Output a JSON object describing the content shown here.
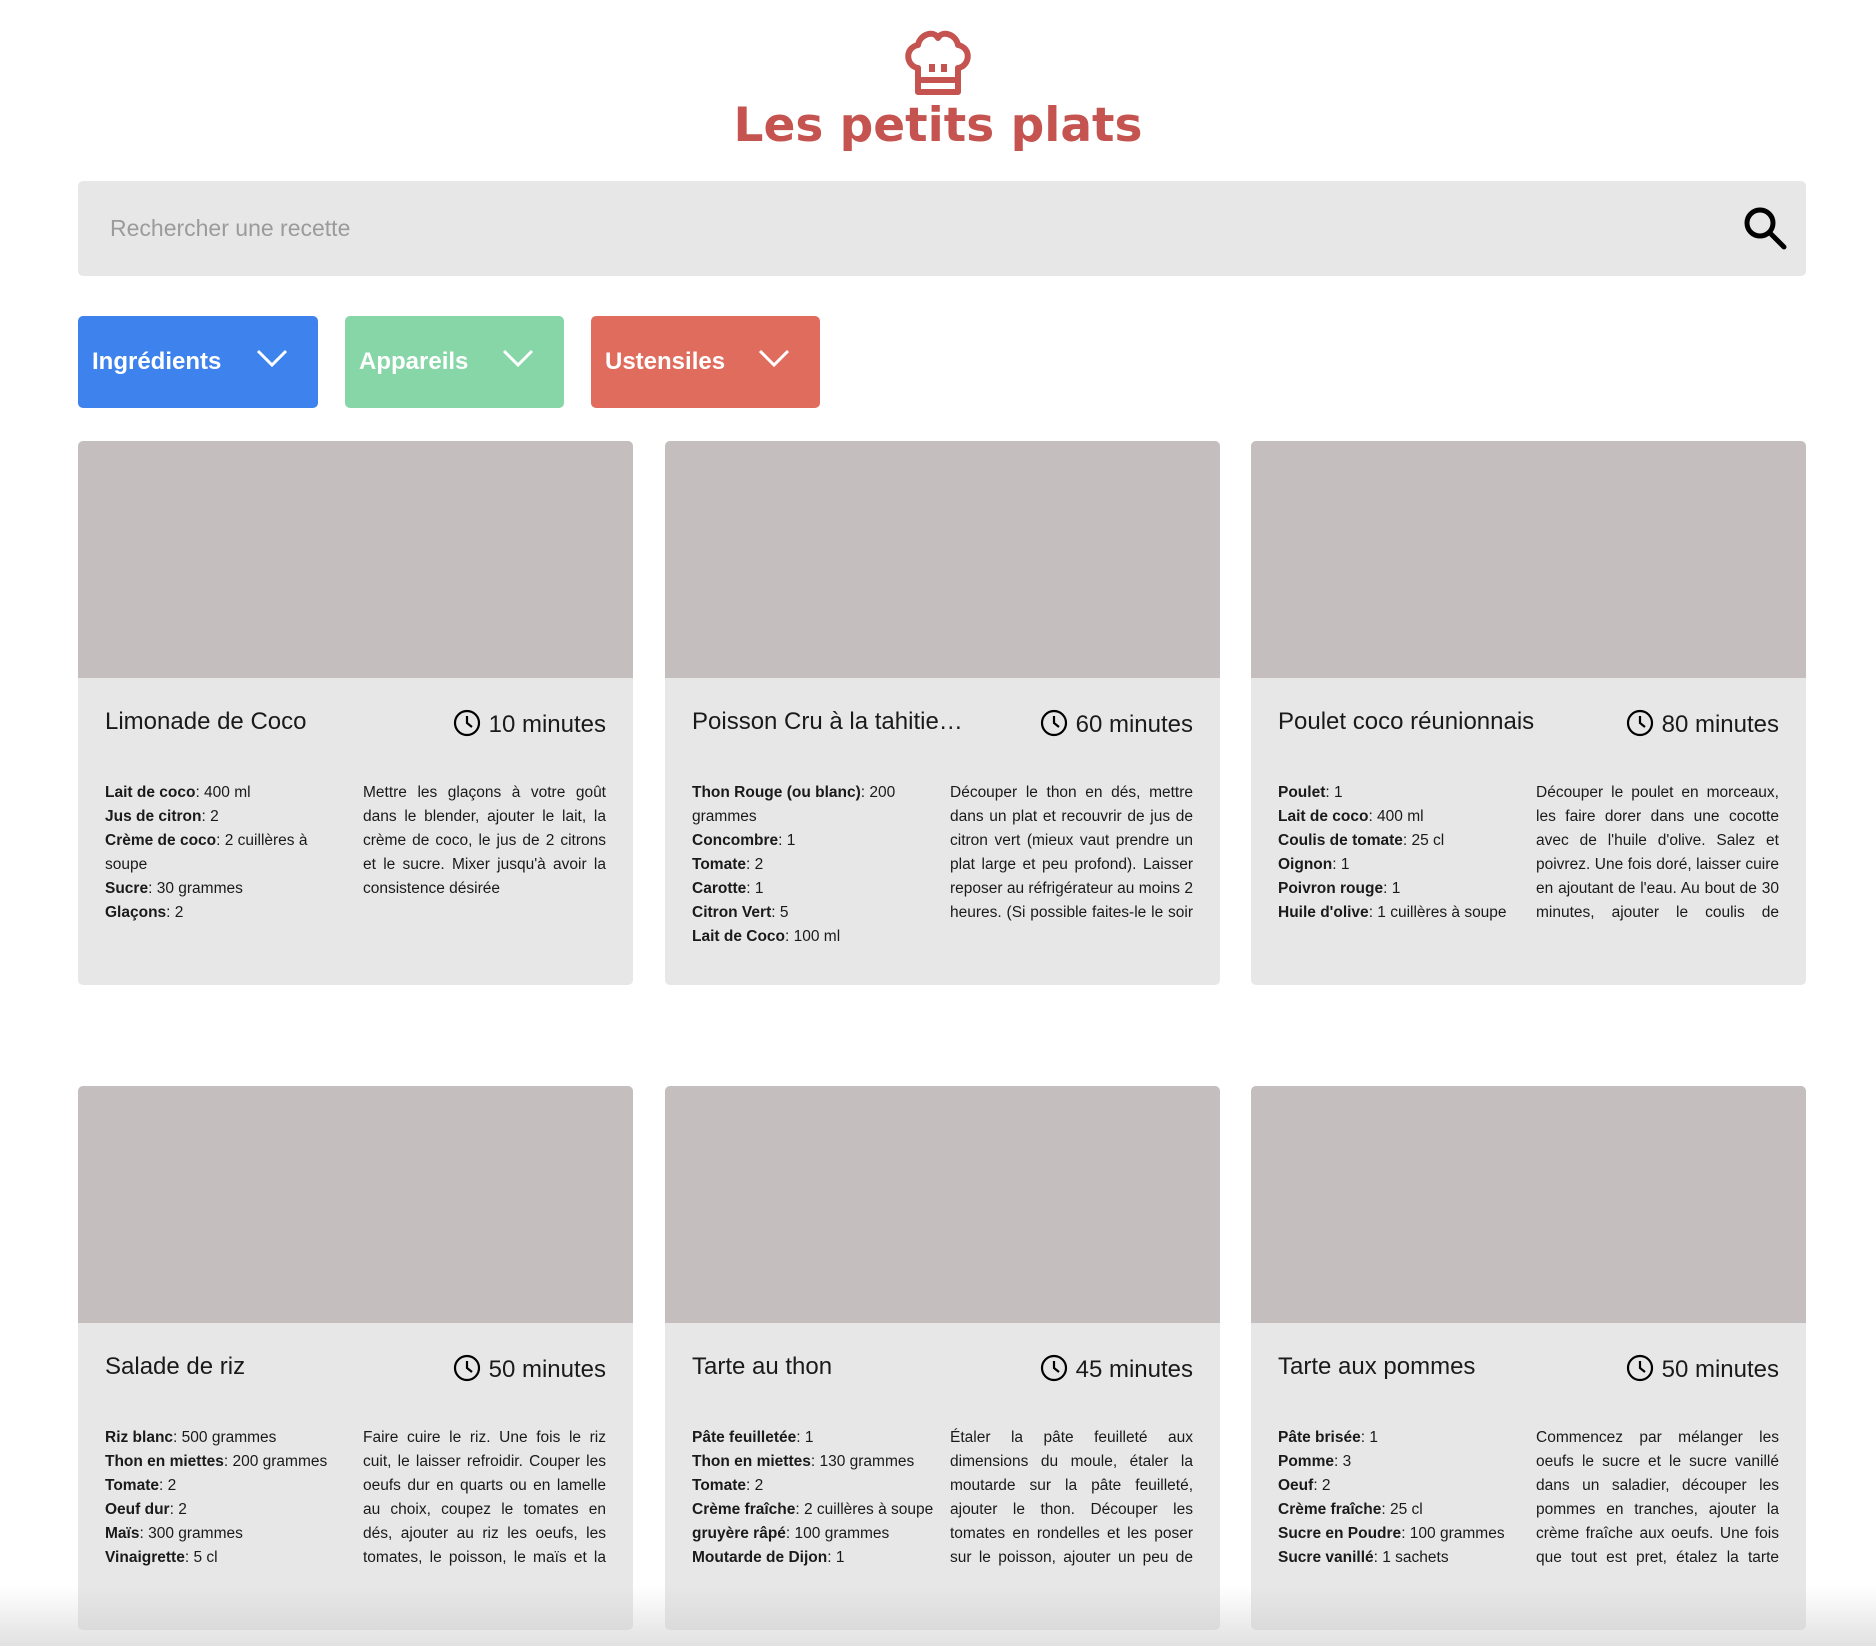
{
  "header": {
    "title": "Les petits plats",
    "logo_icon": "chef-hat-icon",
    "brand_color": "#c5534f"
  },
  "search": {
    "placeholder": "Rechercher une recette",
    "value": "",
    "icon": "search-icon"
  },
  "filters": [
    {
      "label": "Ingrédients",
      "color": "#3e82ed"
    },
    {
      "label": "Appareils",
      "color": "#86d6a8"
    },
    {
      "label": "Ustensiles",
      "color": "#e06c5d"
    }
  ],
  "recipes": [
    {
      "title": "Limonade de Coco",
      "time": "10 minutes",
      "ingredients": [
        {
          "name": "Lait de coco",
          "qty": ": 400 ml"
        },
        {
          "name": "Jus de citron",
          "qty": ": 2"
        },
        {
          "name": "Crème de coco",
          "qty": ": 2 cuillères à soupe"
        },
        {
          "name": "Sucre",
          "qty": ": 30 grammes"
        },
        {
          "name": "Glaçons",
          "qty": ": 2"
        }
      ],
      "description": "Mettre les glaçons à votre goût dans le blender, ajouter le lait, la crème de coco, le jus de 2 citrons et le sucre. Mixer jusqu'à avoir la consistence désirée"
    },
    {
      "title": "Poisson Cru à la tahitie…",
      "time": "60 minutes",
      "ingredients": [
        {
          "name": "Thon Rouge (ou blanc)",
          "qty": ": 200 grammes"
        },
        {
          "name": "Concombre",
          "qty": ": 1"
        },
        {
          "name": "Tomate",
          "qty": ": 2"
        },
        {
          "name": "Carotte",
          "qty": ": 1"
        },
        {
          "name": "Citron Vert",
          "qty": ": 5"
        },
        {
          "name": "Lait de Coco",
          "qty": ": 100 ml"
        }
      ],
      "description": "Découper le thon en dés, mettre dans un plat et recouvrir de jus de citron vert (mieux vaut prendre un plat large et peu profond). Laisser reposer au réfrigérateur au moins 2 heures. (Si possible faites-le le soir pour le lendemain. Après avoir"
    },
    {
      "title": "Poulet coco réunionnais",
      "time": "80 minutes",
      "ingredients": [
        {
          "name": "Poulet",
          "qty": ": 1"
        },
        {
          "name": "Lait de coco",
          "qty": ": 400 ml"
        },
        {
          "name": "Coulis de tomate",
          "qty": ": 25 cl"
        },
        {
          "name": "Oignon",
          "qty": ": 1"
        },
        {
          "name": "Poivron rouge",
          "qty": ": 1"
        },
        {
          "name": "Huile d'olive",
          "qty": ": 1 cuillères à soupe"
        }
      ],
      "description": "Découper le poulet en morceaux, les faire dorer dans une cocotte avec de l'huile d'olive. Salez et poivrez. Une fois doré, laisser cuire en ajoutant de l'eau. Au bout de 30 minutes, ajouter le coulis de tomate, le lait de coco ainsi que le"
    },
    {
      "title": "Salade de riz",
      "time": "50 minutes",
      "ingredients": [
        {
          "name": "Riz blanc",
          "qty": ": 500 grammes"
        },
        {
          "name": "Thon en miettes",
          "qty": ": 200 grammes"
        },
        {
          "name": "Tomate",
          "qty": ": 2"
        },
        {
          "name": "Oeuf dur",
          "qty": ": 2"
        },
        {
          "name": "Maïs",
          "qty": ": 300 grammes"
        },
        {
          "name": "Vinaigrette",
          "qty": ": 5 cl"
        }
      ],
      "description": "Faire cuire le riz. Une fois le riz cuit, le laisser refroidir. Couper les oeufs dur en quarts ou en lamelle au choix, coupez le tomates en dés, ajouter au riz les oeufs, les tomates, le poisson, le maïs et la vinaigrette. Ajouter au gout de"
    },
    {
      "title": "Tarte au thon",
      "time": "45 minutes",
      "ingredients": [
        {
          "name": "Pâte feuilletée",
          "qty": ": 1"
        },
        {
          "name": "Thon en miettes",
          "qty": ": 130 grammes"
        },
        {
          "name": "Tomate",
          "qty": ": 2"
        },
        {
          "name": "Crème fraîche",
          "qty": ": 2 cuillères à soupe"
        },
        {
          "name": "gruyère râpé",
          "qty": ": 100 grammes"
        },
        {
          "name": "Moutarde de Dijon",
          "qty": ": 1"
        }
      ],
      "description": "Étaler la pâte feuilleté aux dimensions du moule, étaler la moutarde sur la pâte feuilleté, ajouter le thon. Découper les tomates en rondelles et les poser sur le poisson, ajouter un peu de crème fraîche sur toute la tarte et"
    },
    {
      "title": "Tarte aux pommes",
      "time": "50 minutes",
      "ingredients": [
        {
          "name": "Pâte brisée",
          "qty": ": 1"
        },
        {
          "name": "Pomme",
          "qty": ": 3"
        },
        {
          "name": "Oeuf",
          "qty": ": 2"
        },
        {
          "name": "Crème fraîche",
          "qty": ": 25 cl"
        },
        {
          "name": "Sucre en Poudre",
          "qty": ": 100 grammes"
        },
        {
          "name": "Sucre vanillé",
          "qty": ": 1 sachets"
        }
      ],
      "description": "Commencez par mélanger les oeufs le sucre et le sucre vanillé dans un saladier, découper les pommes en tranches, ajouter la crème fraîche aux oeufs. Une fois que tout est pret, étalez la tarte dans le moule. N'oubliez pas de"
    }
  ]
}
